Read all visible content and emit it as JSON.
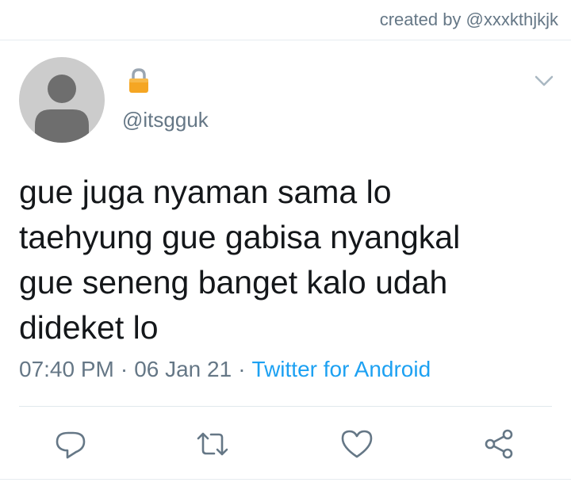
{
  "header": {
    "credit_text": "created by @xxxkthjkjk"
  },
  "tweet": {
    "avatar_icon": "default-avatar-icon",
    "lock_icon": "lock-icon",
    "handle": "@itsgguk",
    "text_lines": [
      "gue juga nyaman sama lo",
      "taehyung gue gabisa nyangkal",
      "gue seneng banget kalo udah",
      "dideket lo"
    ],
    "time": "07:40 PM",
    "separator": "·",
    "date": "06 Jan 21",
    "source": "Twitter for Android"
  },
  "actions": [
    {
      "name": "reply",
      "icon": "comment-icon"
    },
    {
      "name": "retweet",
      "icon": "retweet-icon"
    },
    {
      "name": "like",
      "icon": "heart-icon"
    },
    {
      "name": "share",
      "icon": "share-icon"
    }
  ],
  "colors": {
    "text": "#14171a",
    "muted": "#657786",
    "accent": "#1da1f2",
    "avatar_bg": "#cccccc",
    "avatar_fg": "#6e6e6e",
    "lock_body": "#f5a623",
    "lock_shackle": "#9aa5b1"
  }
}
